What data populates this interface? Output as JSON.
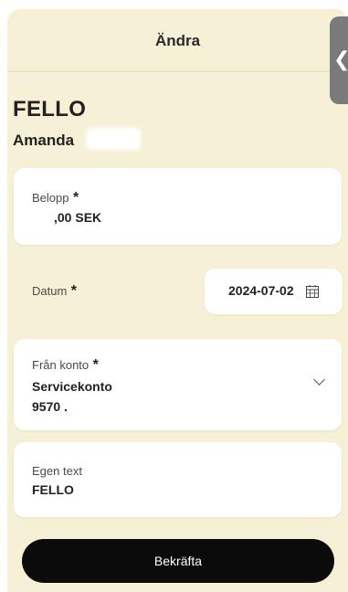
{
  "header": {
    "title": "Ändra"
  },
  "payee": {
    "name": "FELLO",
    "sub": "Amanda"
  },
  "amount": {
    "label": "Belopp",
    "required": "*",
    "value": ",00 SEK"
  },
  "date": {
    "label": "Datum",
    "required": "*",
    "value": "2024-07-02"
  },
  "from_account": {
    "label": "Från konto",
    "required": "*",
    "name": "Servicekonto",
    "number": "9570 ."
  },
  "own_text": {
    "label": "Egen text",
    "value": "FELLO"
  },
  "confirm": {
    "label": "Bekräfta"
  },
  "colors": {
    "sheet": "#f6f1d6",
    "button": "#0b0b0b",
    "card": "#ffffff"
  }
}
